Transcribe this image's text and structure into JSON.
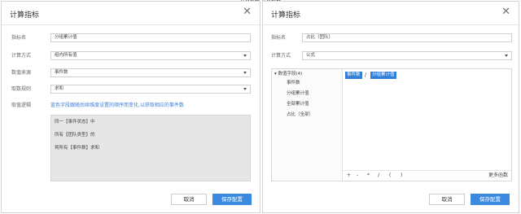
{
  "top_caption": "计算指标  计算指标",
  "left": {
    "title": "计算指标",
    "fields": {
      "name_label": "指标名",
      "name_value": "分组累计值",
      "method_label": "计算方式",
      "method_value": "组内所有值",
      "source_label": "数值来源",
      "source_value": "事件数",
      "rule_label": "取数规则",
      "rule_value": "求和",
      "logic_label": "取值逻辑"
    },
    "hint": "蓝色字段跟随后续维度设置的顺序而变化,以获取相应的事件数",
    "logic_lines": [
      "同一【事件状态】中",
      "所有【团队类型】的",
      "将所有【事件数】求和"
    ],
    "cancel_label": "取消",
    "save_label": "保存配置"
  },
  "right": {
    "title": "计算指标",
    "fields": {
      "name_label": "指标名",
      "name_value": "占比（团队）",
      "method_label": "计算方式",
      "method_value": "公式"
    },
    "tree": {
      "group_label": "数值字段(4)",
      "items": [
        "事件数",
        "分组累计值",
        "全部累计值",
        "占比（全部）"
      ]
    },
    "formula": {
      "token1": "事件数",
      "operator": "/",
      "token2": "分组累计值"
    },
    "operators": [
      "+",
      "-",
      "*",
      "/",
      "(",
      ")"
    ],
    "more_label": "更多函数",
    "cancel_label": "取消",
    "save_label": "保存配置"
  }
}
